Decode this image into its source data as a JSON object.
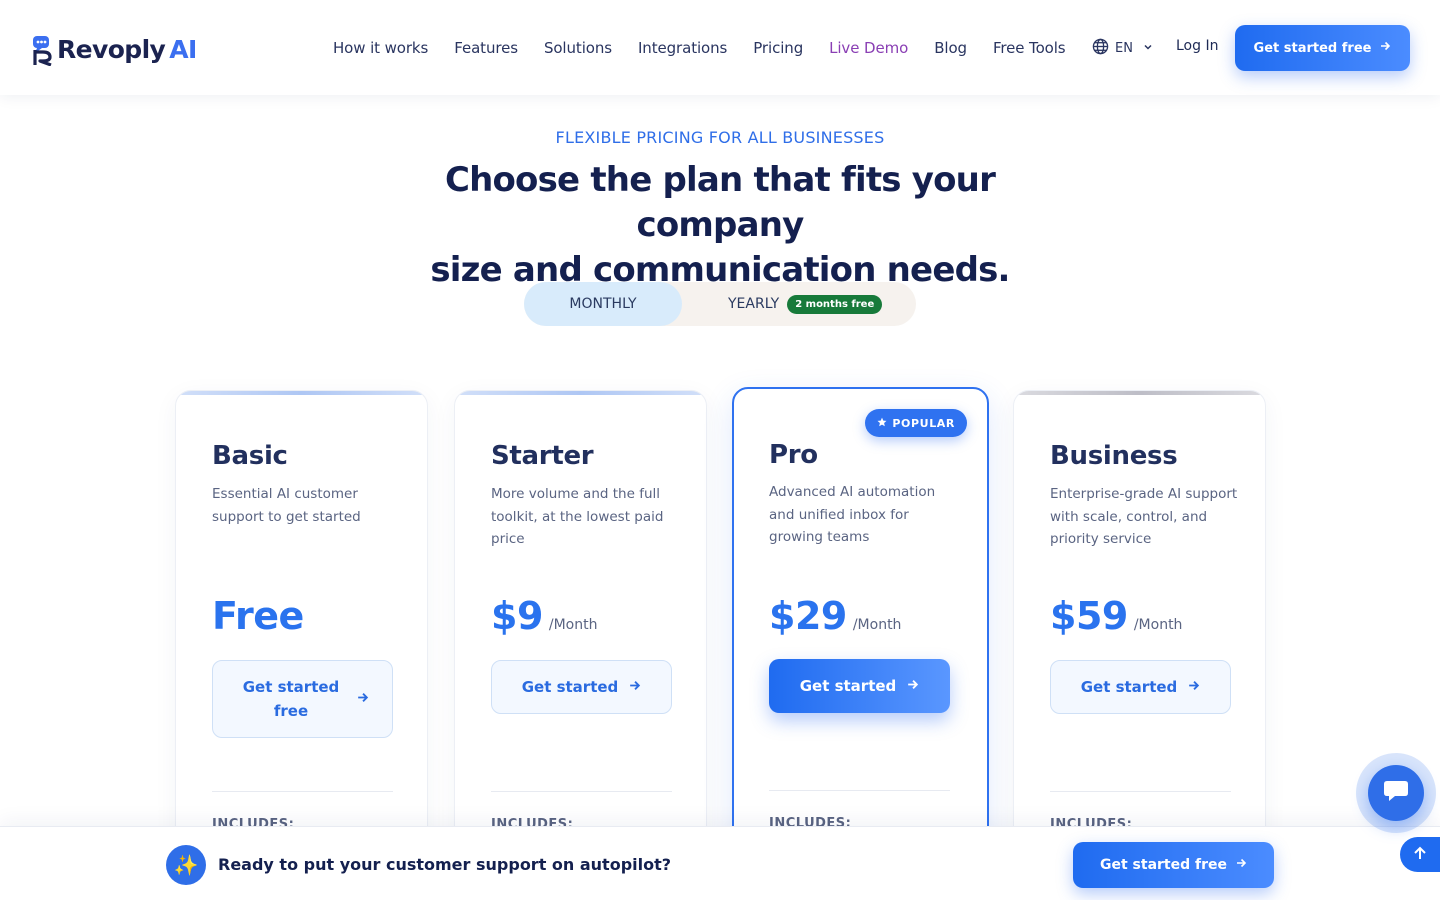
{
  "header": {
    "logo": {
      "text": "Revoply",
      "accent": "AI"
    },
    "nav": [
      "How it works",
      "Features",
      "Solutions",
      "Integrations",
      "Pricing",
      "Live Demo",
      "Blog",
      "Free Tools"
    ],
    "language": "EN",
    "login_label": "Log In",
    "cta_label": "Get started free"
  },
  "hero": {
    "eyebrow": "FLEXIBLE PRICING FOR ALL BUSINESSES",
    "title_line1": "Choose the plan that fits your company",
    "title_line2": "size and communication needs."
  },
  "billing_toggle": {
    "monthly": "MONTHLY",
    "yearly": "YEARLY",
    "yearly_badge": "2 months free",
    "selected": "MONTHLY"
  },
  "plans": [
    {
      "name": "Basic",
      "description": "Essential AI customer support to get started",
      "price": "Free",
      "period": "",
      "button": "Get started free",
      "includes": "INCLUDES:"
    },
    {
      "name": "Starter",
      "description": "More volume and the full toolkit, at the lowest paid price",
      "price": "$9",
      "period": "/Month",
      "button": "Get started",
      "includes": "INCLUDES:"
    },
    {
      "name": "Pro",
      "description": "Advanced AI automation and unified inbox for growing teams",
      "price": "$29",
      "period": "/Month",
      "button": "Get started",
      "includes": "INCLUDES:",
      "badge": "POPULAR"
    },
    {
      "name": "Business",
      "description": "Enterprise-grade AI support with scale, control, and priority service",
      "price": "$59",
      "period": "/Month",
      "button": "Get started",
      "includes": "INCLUDES:"
    }
  ],
  "bottom_bar": {
    "text": "Ready to put your customer support on autopilot?",
    "cta_label": "Get started free"
  },
  "colors": {
    "primary": "#2f6ee8",
    "heading": "#14204f",
    "live_demo": "#8a3fb4",
    "badge_green": "#177a3a"
  }
}
